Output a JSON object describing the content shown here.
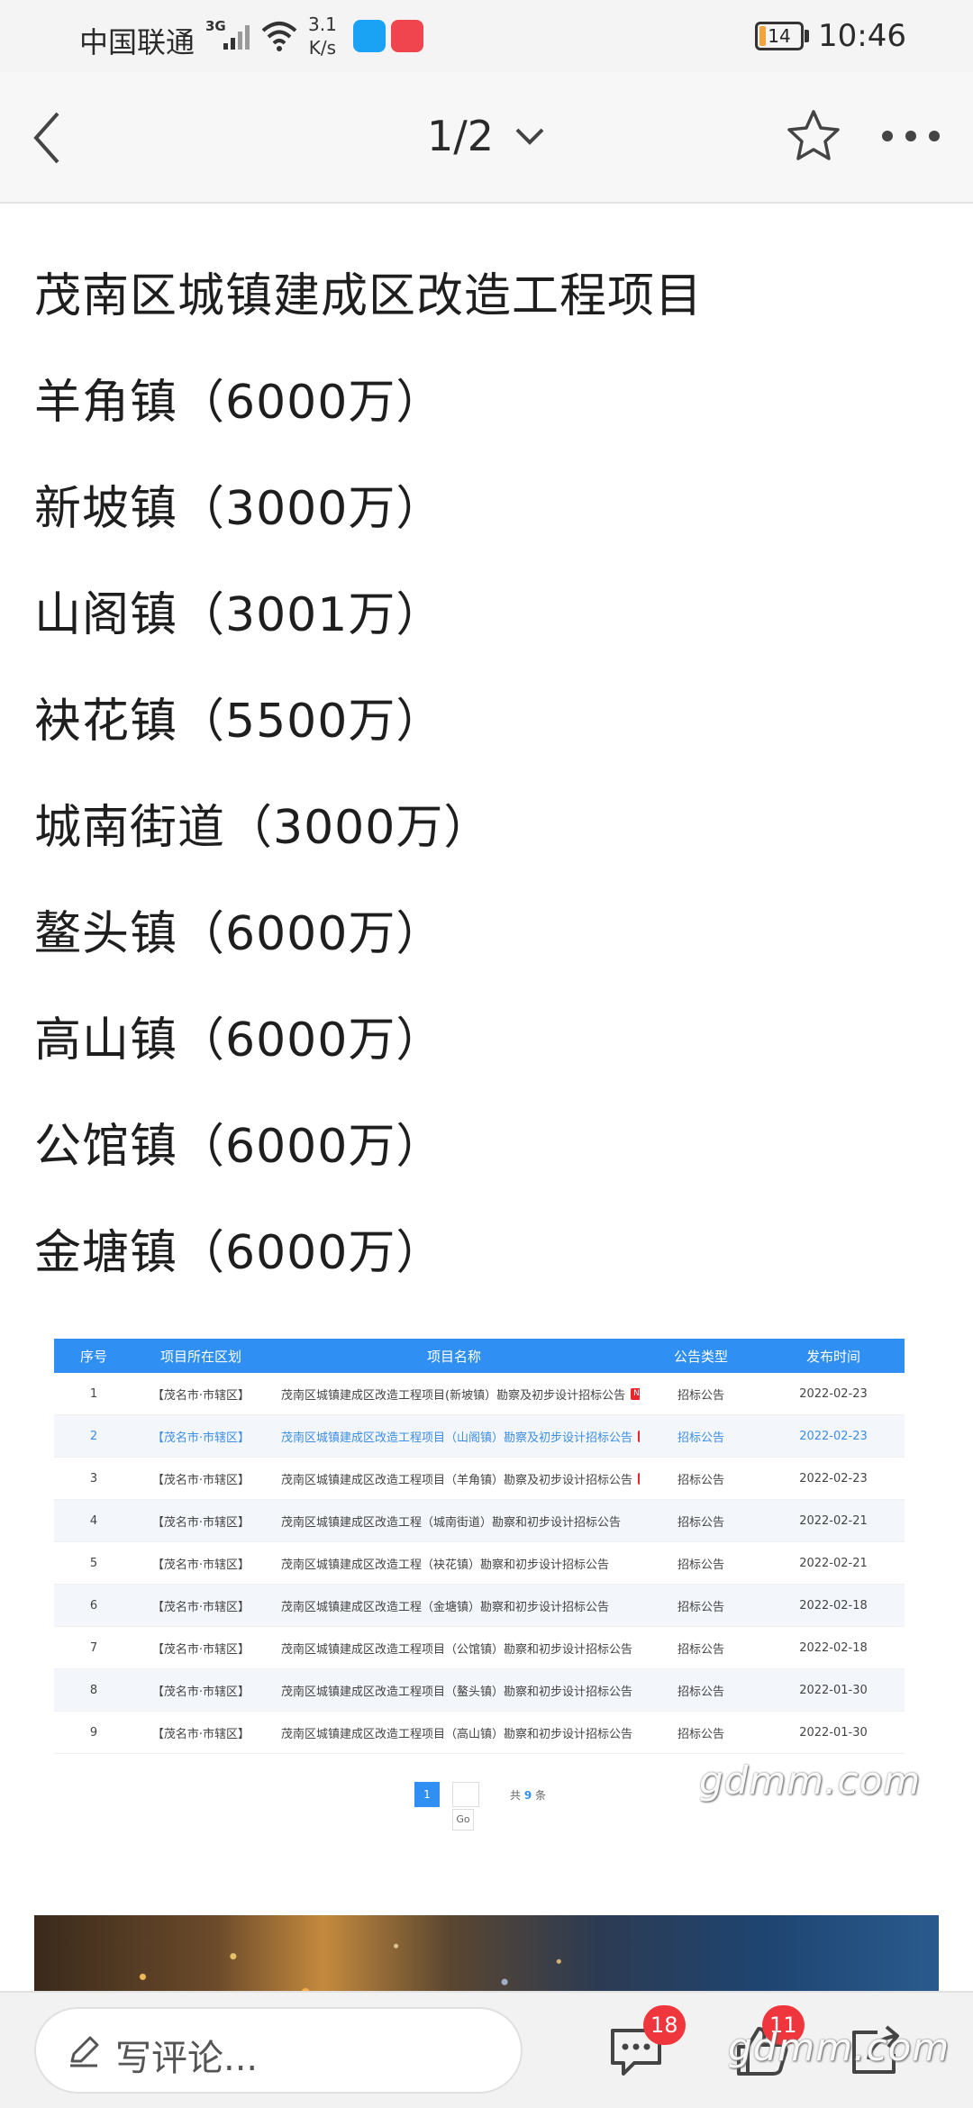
{
  "status_bar": {
    "carrier": "中国联通",
    "network": "3G",
    "speed_value": "3.1",
    "speed_unit": "K/s",
    "battery": "14",
    "battery_level": 0.14,
    "time": "10:46",
    "icons": [
      "signal-icon",
      "wifi-icon",
      "search-app-icon",
      "huawei-app-icon",
      "battery-icon"
    ]
  },
  "nav": {
    "page_indicator": "1/2",
    "icons": [
      "back-arrow-icon",
      "chevron-down-icon",
      "star-icon",
      "more-dots-icon"
    ]
  },
  "article": {
    "lines": [
      "茂南区城镇建成区改造工程项目",
      "羊角镇（6000万）",
      "新坡镇（3000万）",
      "山阁镇（3001万）",
      "袂花镇（5500万）",
      "城南街道（3000万）",
      "鳌头镇（6000万）",
      "高山镇（6000万）",
      "公馆镇（6000万）",
      "金塘镇（6000万）"
    ]
  },
  "table": {
    "headers": [
      "序号",
      "项目所在区划",
      "项目名称",
      "公告类型",
      "发布时间"
    ],
    "new_tag": "NEW",
    "rows": [
      {
        "no": "1",
        "region": "【茂名市·市辖区】",
        "name": "茂南区城镇建成区改造工程项目(新坡镇）勘察及初步设计招标公告",
        "type": "招标公告",
        "date": "2022-02-23",
        "is_new": true
      },
      {
        "no": "2",
        "region": "【茂名市·市辖区】",
        "name": "茂南区城镇建成区改造工程项目（山阁镇）勘察及初步设计招标公告",
        "type": "招标公告",
        "date": "2022-02-23",
        "is_new": true
      },
      {
        "no": "3",
        "region": "【茂名市·市辖区】",
        "name": "茂南区城镇建成区改造工程项目（羊角镇）勘察及初步设计招标公告",
        "type": "招标公告",
        "date": "2022-02-23",
        "is_new": true
      },
      {
        "no": "4",
        "region": "【茂名市·市辖区】",
        "name": "茂南区城镇建成区改造工程（城南街道）勘察和初步设计招标公告",
        "type": "招标公告",
        "date": "2022-02-21",
        "is_new": false
      },
      {
        "no": "5",
        "region": "【茂名市·市辖区】",
        "name": "茂南区城镇建成区改造工程（袂花镇）勘察和初步设计招标公告",
        "type": "招标公告",
        "date": "2022-02-21",
        "is_new": false
      },
      {
        "no": "6",
        "region": "【茂名市·市辖区】",
        "name": "茂南区城镇建成区改造工程（金塘镇）勘察和初步设计招标公告",
        "type": "招标公告",
        "date": "2022-02-18",
        "is_new": false
      },
      {
        "no": "7",
        "region": "【茂名市·市辖区】",
        "name": "茂南区城镇建成区改造工程项目（公馆镇）勘察和初步设计招标公告",
        "type": "招标公告",
        "date": "2022-02-18",
        "is_new": false
      },
      {
        "no": "8",
        "region": "【茂名市·市辖区】",
        "name": "茂南区城镇建成区改造工程项目（鳌头镇）勘察和初步设计招标公告",
        "type": "招标公告",
        "date": "2022-01-30",
        "is_new": false
      },
      {
        "no": "9",
        "region": "【茂名市·市辖区】",
        "name": "茂南区城镇建成区改造工程项目（高山镇）勘察和初步设计招标公告",
        "type": "招标公告",
        "date": "2022-01-30",
        "is_new": false
      }
    ],
    "pager": {
      "current_page": "1",
      "total_prefix": "共",
      "total_count": "9",
      "total_suffix": "条",
      "go_label": "Go"
    }
  },
  "watermark": "gdmm.com",
  "bottom_bar": {
    "comment_placeholder": "写评论...",
    "comments_count": "18",
    "likes_count": "11",
    "icons": [
      "pen-icon",
      "comment-icon",
      "like-icon",
      "share-icon"
    ]
  },
  "colors": {
    "table_header": "#2f8ff2",
    "highlight_row": "#3d8ee6",
    "badge": "#f0363d",
    "new_tag": "#e8262b"
  }
}
